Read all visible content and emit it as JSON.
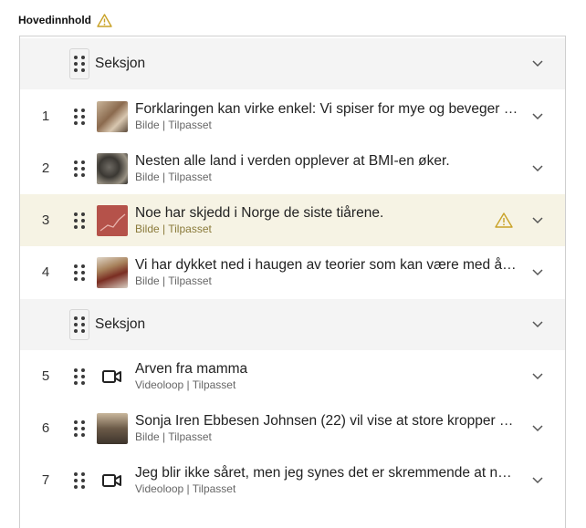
{
  "header": {
    "title": "Hovedinnhold"
  },
  "colors": {
    "warning": "#c9a227",
    "section_bg": "#f4f4f4",
    "warning_bg": "#f6f3e4"
  },
  "rows": [
    {
      "type": "section",
      "label": "Seksjon"
    },
    {
      "type": "item",
      "number": "1",
      "title": "Forklaringen kan virke enkel: Vi spiser for mye og beveger o...",
      "meta": "Bilde | Tilpasset",
      "media": "image"
    },
    {
      "type": "item",
      "number": "2",
      "title": "Nesten alle land i verden opplever at BMI-en øker.",
      "meta": "Bilde | Tilpasset",
      "media": "image"
    },
    {
      "type": "item",
      "number": "3",
      "title": "Noe har skjedd i Norge de siste tiårene.",
      "meta": "Bilde | Tilpasset",
      "media": "image",
      "warning": true
    },
    {
      "type": "item",
      "number": "4",
      "title": "Vi har dykket ned i haugen av teorier som kan være med å f...",
      "meta": "Bilde | Tilpasset",
      "media": "image"
    },
    {
      "type": "section",
      "label": "Seksjon"
    },
    {
      "type": "item",
      "number": "5",
      "title": "Arven fra mamma",
      "meta": "Videoloop | Tilpasset",
      "media": "video"
    },
    {
      "type": "item",
      "number": "6",
      "title": "Sonja Iren Ebbesen Johnsen (22) vil vise at store kropper er...",
      "meta": "Bilde | Tilpasset",
      "media": "image"
    },
    {
      "type": "item",
      "number": "7",
      "title": "Jeg blir ikke såret, men jeg synes det er skremmende at noe...",
      "meta": "Videoloop | Tilpasset",
      "media": "video"
    }
  ]
}
